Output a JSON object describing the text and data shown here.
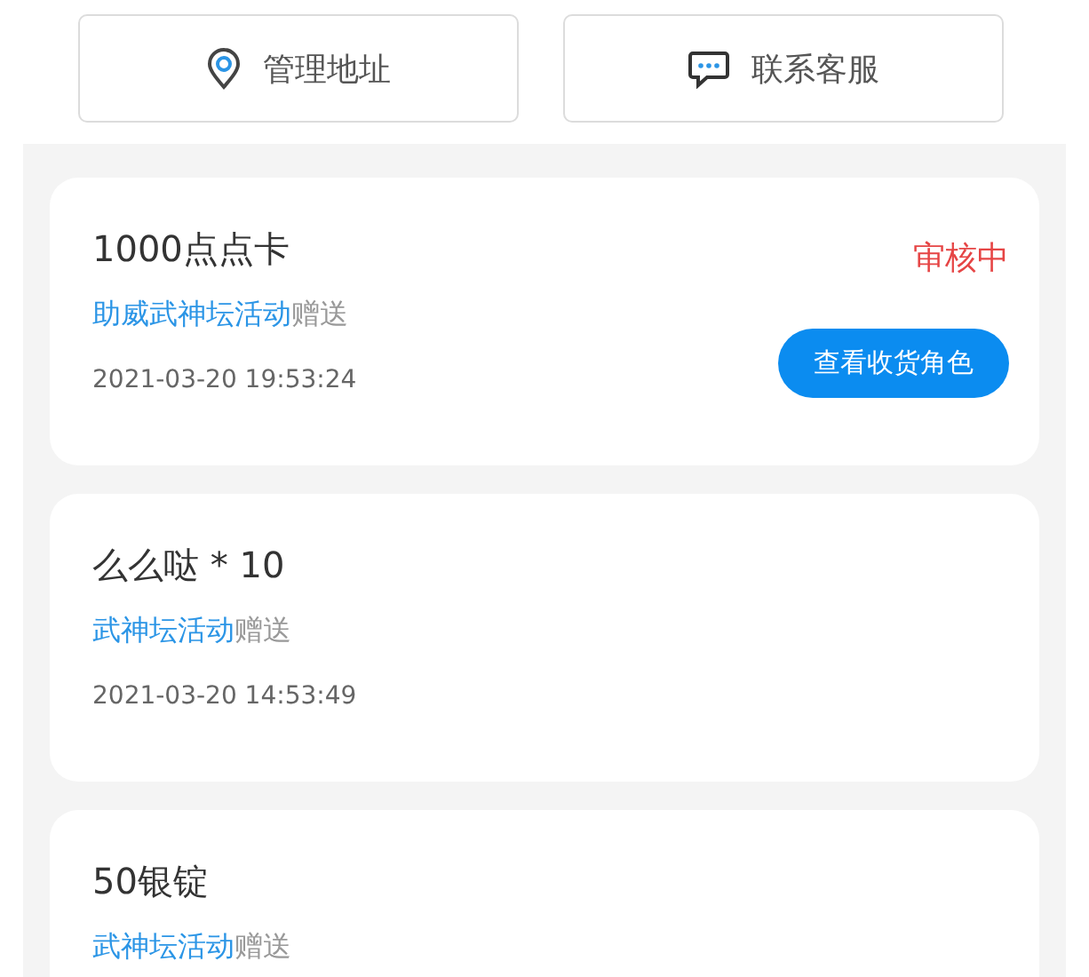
{
  "actions": [
    {
      "label": "管理地址",
      "kind": "location"
    },
    {
      "label": "联系客服",
      "kind": "chat"
    }
  ],
  "orders": [
    {
      "title": "1000点点卡",
      "source_event": "助威武神坛活动",
      "source_suffix": "赠送",
      "time": "2021-03-20 19:53:24",
      "status": "审核中",
      "button": "查看收货角色"
    },
    {
      "title": "么么哒 * 10",
      "source_event": "武神坛活动",
      "source_suffix": "赠送",
      "time": "2021-03-20 14:53:49"
    },
    {
      "title": "50银锭",
      "source_event": "武神坛活动",
      "source_suffix": "赠送"
    }
  ]
}
